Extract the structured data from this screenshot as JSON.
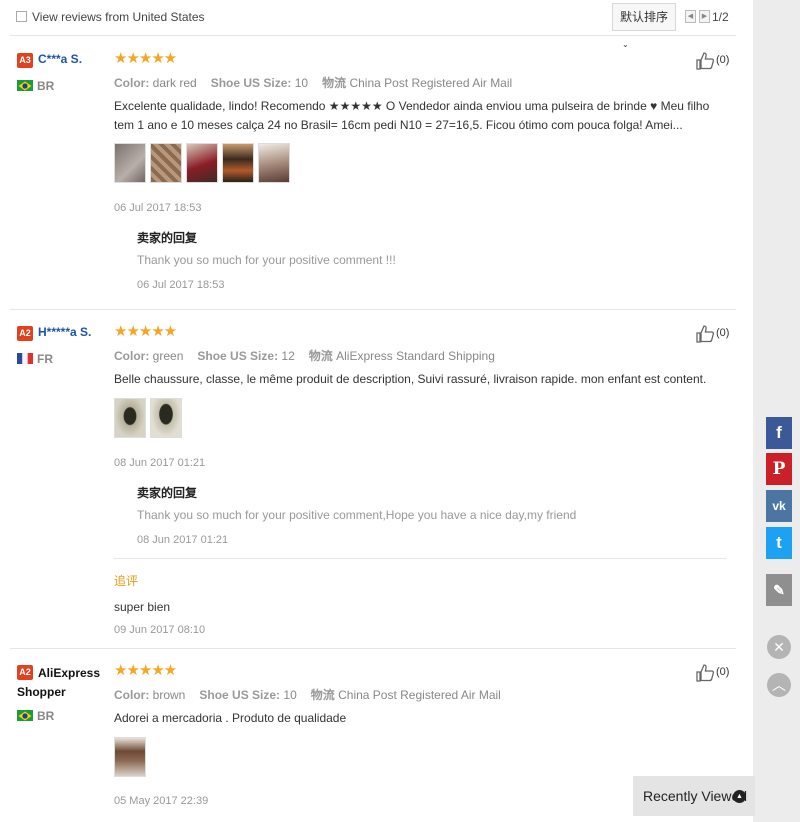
{
  "toolbar": {
    "checkbox_label": "View reviews from United States",
    "sort_label": "默认排序",
    "prev_icon": "chevron-left-icon",
    "next_icon": "chevron-right-icon",
    "page_text": "1/2"
  },
  "reviews": [
    {
      "badge": "A3",
      "name": "C***a S.",
      "country": "BR",
      "stars": "★★★★★",
      "color_label": "Color:",
      "color_value": "dark red",
      "shoe_label": "Shoe US Size:",
      "shoe_value": "10",
      "ship_label": "物流",
      "ship_value": "China Post Registered Air Mail",
      "text": "Excelente qualidade, lindo! Recomendo ★★★★★ O Vendedor ainda enviou uma pulseira de brinde ♥ Meu filho tem 1 ano e 10 meses calça 24 no Brasil= 16cm pedi N10 = 27=16,5. Ficou ótimo com pouca folga! Amei...",
      "date": "06 Jul 2017 18:53",
      "reply_heading": "卖家的回复",
      "reply_text": "Thank you so much for your positive comment !!!",
      "reply_date": "06 Jul 2017 18:53",
      "likes": "(0)"
    },
    {
      "badge": "A2",
      "name": "H*****a S.",
      "country": "FR",
      "stars": "★★★★★",
      "color_label": "Color:",
      "color_value": "green",
      "shoe_label": "Shoe US Size:",
      "shoe_value": "12",
      "ship_label": "物流",
      "ship_value": "AliExpress Standard Shipping",
      "text": "Belle chaussure, classe, le même produit de description, Suivi rassuré, livraison rapide. mon enfant est content.",
      "date": "08 Jun 2017 01:21",
      "reply_heading": "卖家的回复",
      "reply_text": "Thank you so much for your positive comment,Hope you have a nice day,my friend",
      "reply_date": "08 Jun 2017 01:21",
      "followup_heading": "追评",
      "followup_text": "super bien",
      "followup_date": "09 Jun 2017 08:10",
      "likes": "(0)"
    },
    {
      "badge": "A2",
      "name": "AliExpress Shopper",
      "country": "BR",
      "stars": "★★★★★",
      "color_label": "Color:",
      "color_value": "brown",
      "shoe_label": "Shoe US Size:",
      "shoe_value": "10",
      "ship_label": "物流",
      "ship_value": "China Post Registered Air Mail",
      "text": "Adorei a mercadoria . Produto de qualidade",
      "date": "05 May 2017 22:39",
      "likes": "(0)"
    }
  ],
  "social": {
    "facebook": "f",
    "pinterest": "P",
    "vk": "vk",
    "twitter": "t"
  },
  "recently_viewed": "Recently Viewed"
}
